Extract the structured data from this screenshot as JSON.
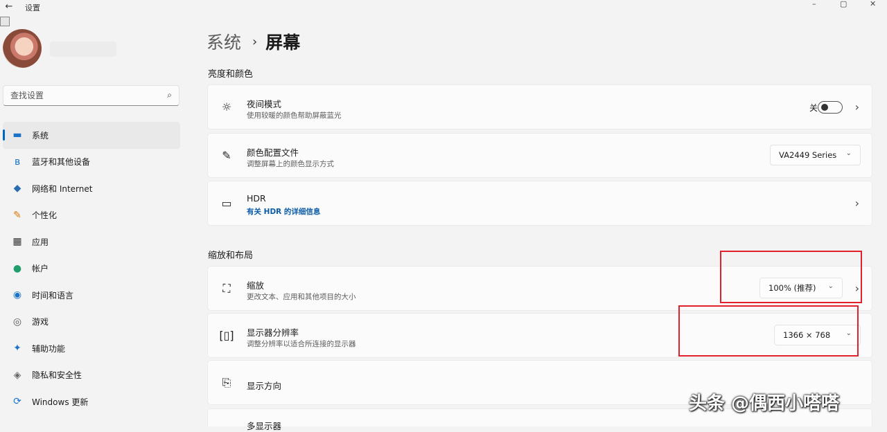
{
  "window": {
    "title": "设置",
    "back_glyph": "←",
    "minimize_glyph": "–",
    "maximize_glyph": "▢",
    "close_glyph": "✕"
  },
  "sidebar": {
    "search": {
      "placeholder": "查找设置"
    },
    "items": [
      {
        "label": "系统",
        "icon": "monitor-icon",
        "glyph": "▬",
        "color": "#1a73c7",
        "selected": true
      },
      {
        "label": "蓝牙和其他设备",
        "icon": "bluetooth-icon",
        "glyph": "ʙ",
        "color": "#1a73c7"
      },
      {
        "label": "网络和 Internet",
        "icon": "wifi-icon",
        "glyph": "◆",
        "color": "#2b6cb0"
      },
      {
        "label": "个性化",
        "icon": "brush-icon",
        "glyph": "✎",
        "color": "#d97706"
      },
      {
        "label": "应用",
        "icon": "apps-icon",
        "glyph": "▦",
        "color": "#333333"
      },
      {
        "label": "帐户",
        "icon": "user-icon",
        "glyph": "●",
        "color": "#1e9e6a"
      },
      {
        "label": "时间和语言",
        "icon": "clock-globe-icon",
        "glyph": "◉",
        "color": "#1a73c7"
      },
      {
        "label": "游戏",
        "icon": "gamepad-icon",
        "glyph": "◎",
        "color": "#555555"
      },
      {
        "label": "辅助功能",
        "icon": "accessibility-icon",
        "glyph": "✦",
        "color": "#1a73c7"
      },
      {
        "label": "隐私和安全性",
        "icon": "shield-icon",
        "glyph": "◈",
        "color": "#666666"
      },
      {
        "label": "Windows 更新",
        "icon": "update-icon",
        "glyph": "⟳",
        "color": "#1a73c7"
      }
    ]
  },
  "header": {
    "parent": "系统",
    "separator": "›",
    "current": "屏幕"
  },
  "sections": {
    "brightness_color": "亮度和颜色",
    "scale_layout": "缩放和布局"
  },
  "cards": {
    "night_light": {
      "title": "夜间模式",
      "subtitle": "使用较暖的颜色帮助屏蔽蓝光",
      "toggle_label": "关",
      "toggle_on": false
    },
    "color_profile": {
      "title": "颜色配置文件",
      "subtitle": "调整屏幕上的颜色显示方式",
      "value": "VA2449 Series"
    },
    "hdr": {
      "title": "HDR",
      "link": "有关 HDR 的详细信息"
    },
    "scale": {
      "title": "缩放",
      "subtitle": "更改文本、应用和其他项目的大小",
      "value": "100% (推荐)"
    },
    "resolution": {
      "title": "显示器分辨率",
      "subtitle": "调整分辨率以适合所连接的显示器",
      "value": "1366 × 768"
    },
    "orientation": {
      "title": "显示方向"
    },
    "multi_display": {
      "title": "多显示器"
    }
  },
  "watermark": {
    "text": "头条 @偶西小嗒嗒"
  },
  "colors": {
    "accent": "#0067c0",
    "highlight": "#e0202a"
  }
}
